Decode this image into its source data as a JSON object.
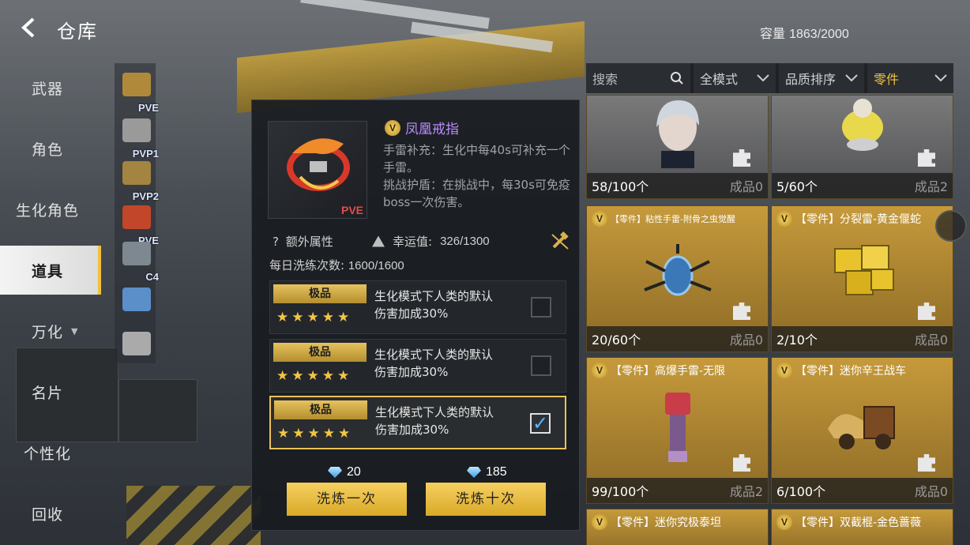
{
  "topbar": {
    "title": "仓库",
    "capacity_label": "容量",
    "capacity_value": "1863/2000"
  },
  "sidebar": {
    "items": [
      {
        "label": "武器"
      },
      {
        "label": "角色"
      },
      {
        "label": "生化角色"
      },
      {
        "label": "道具"
      },
      {
        "label": "万化"
      },
      {
        "label": "名片"
      },
      {
        "label": "个性化"
      },
      {
        "label": "回收"
      }
    ],
    "selected": "道具"
  },
  "thumbs": [
    {
      "label": "PVE",
      "icon": "winged-item-icon",
      "color": "#b08a3a"
    },
    {
      "label": "PVP1",
      "icon": "skull-item-icon",
      "color": "#9a9a9a"
    },
    {
      "label": "PVP2",
      "icon": "crossbow-item-icon",
      "color": "#a38440"
    },
    {
      "label": "PVE",
      "icon": "phoenix-ring-icon",
      "color": "#c2462a"
    },
    {
      "label": "C4",
      "icon": "c4-bomb-icon",
      "color": "#7e8890"
    },
    {
      "label": "",
      "icon": "helmet-icon",
      "color": "#5b8fc9"
    },
    {
      "label": "",
      "icon": "charm-icon",
      "color": "#aaaaaa"
    }
  ],
  "detail": {
    "tag": "PVE",
    "name": "凤凰戒指",
    "desc1": "手雷补充：生化中每40s可补充一个手雷。",
    "desc2": "挑战护盾：在挑战中，每30s可免疫boss一次伤害。",
    "extra_label": "额外属性",
    "luck_label": "幸运值:",
    "luck_value": "326/1300",
    "daily_label": "每日洗练次数:",
    "daily_value": "1600/1600",
    "options": [
      {
        "grade": "极品",
        "stars": "★★★★★",
        "line1": "生化模式下人类的默认",
        "line2": "伤害加成30%",
        "checked": false
      },
      {
        "grade": "极品",
        "stars": "★★★★★",
        "line1": "生化模式下人类的默认",
        "line2": "伤害加成30%",
        "checked": false
      },
      {
        "grade": "极品",
        "stars": "★★★★★",
        "line1": "生化模式下人类的默认",
        "line2": "伤害加成30%",
        "checked": true
      }
    ],
    "cost_once": "20",
    "cost_ten": "185",
    "btn_once": "洗炼一次",
    "btn_ten": "洗炼十次"
  },
  "filters": {
    "search": "搜索",
    "mode": "全模式",
    "sort": "品质排序",
    "category": "零件"
  },
  "cards": [
    {
      "name": "",
      "count": "58/100个",
      "made": "成品0",
      "art": "character-portrait-icon",
      "grey": true
    },
    {
      "name": "",
      "count": "5/60个",
      "made": "成品2",
      "art": "yellow-creature-icon",
      "grey": true
    },
    {
      "name": "【零件】粘性手雷-附骨之虫觉醒",
      "count": "20/60个",
      "made": "成品0",
      "art": "spider-grenade-icon",
      "grey": false
    },
    {
      "name": "【零件】分裂雷-黄金偃蛇",
      "count": "2/10个",
      "made": "成品0",
      "art": "gold-cube-grenade-icon",
      "grey": false
    },
    {
      "name": "【零件】高爆手雷-无限",
      "count": "99/100个",
      "made": "成品2",
      "art": "red-grenade-icon",
      "grey": false
    },
    {
      "name": "【零件】迷你辛王战车",
      "count": "6/100个",
      "made": "成品0",
      "art": "mini-chariot-icon",
      "grey": false
    },
    {
      "name": "【零件】迷你究极泰坦",
      "count": "",
      "made": "",
      "art": "",
      "grey": false
    },
    {
      "name": "【零件】双截棍-金色蔷薇",
      "count": "",
      "made": "",
      "art": "",
      "grey": false
    }
  ],
  "colors": {
    "accent": "#f1c340",
    "panel": "#181b1f",
    "card_gold": "#c69a3b",
    "legendary_text": "#b98cff"
  }
}
